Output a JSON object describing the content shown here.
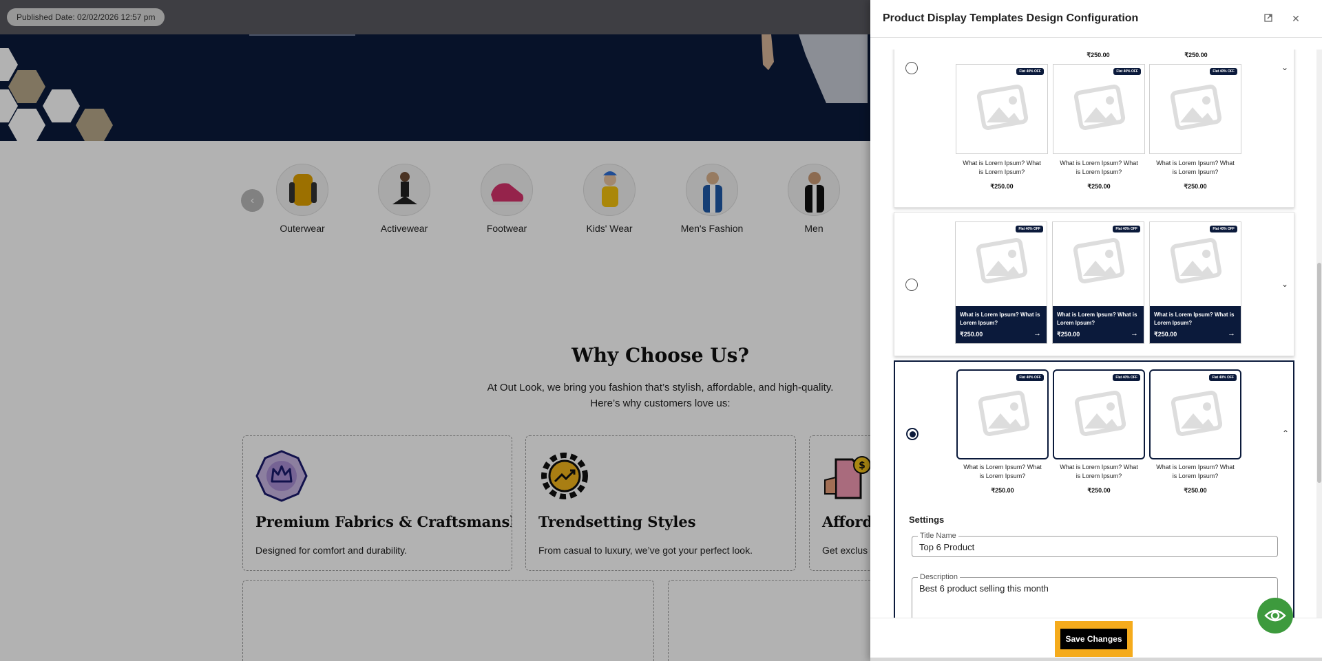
{
  "page": {
    "published_badge": "Published Date: 02/02/2026 12:57 pm",
    "categories": [
      {
        "label": "Outerwear"
      },
      {
        "label": "Activewear"
      },
      {
        "label": "Footwear"
      },
      {
        "label": "Kids' Wear"
      },
      {
        "label": "Men's Fashion"
      },
      {
        "label": "Men"
      }
    ],
    "why": {
      "title": "Why Choose Us?",
      "line1": "At Out Look, we bring you fashion that’s stylish, affordable, and high-quality.",
      "line2": "Here’s why customers love us:"
    },
    "features": [
      {
        "title": "Premium Fabrics & Craftsmanship",
        "desc": "Designed for comfort and durability."
      },
      {
        "title": "Trendsetting Styles",
        "desc": "From casual to luxury, we’ve got your perfect look."
      },
      {
        "title": "Afforda",
        "desc": "Get exclus"
      }
    ]
  },
  "drawer": {
    "title": "Product Display Templates Design Configuration",
    "top_prices": [
      "₹250.00",
      "₹250.00"
    ],
    "product": {
      "tag": "Flat 40% OFF",
      "name": "What is Lorem Ipsum? What is Lorem Ipsum?",
      "price": "₹250.00"
    },
    "settings": {
      "heading": "Settings",
      "title_label": "Title Name",
      "title_value": "Top 6 Product",
      "desc_label": "Description",
      "desc_value": "Best 6 product selling this month"
    },
    "save_label": "Save Changes"
  },
  "colors": {
    "navy": "#0b1a3b",
    "save_highlight": "#f5ab1c",
    "eye_button": "#3d9a3d"
  }
}
